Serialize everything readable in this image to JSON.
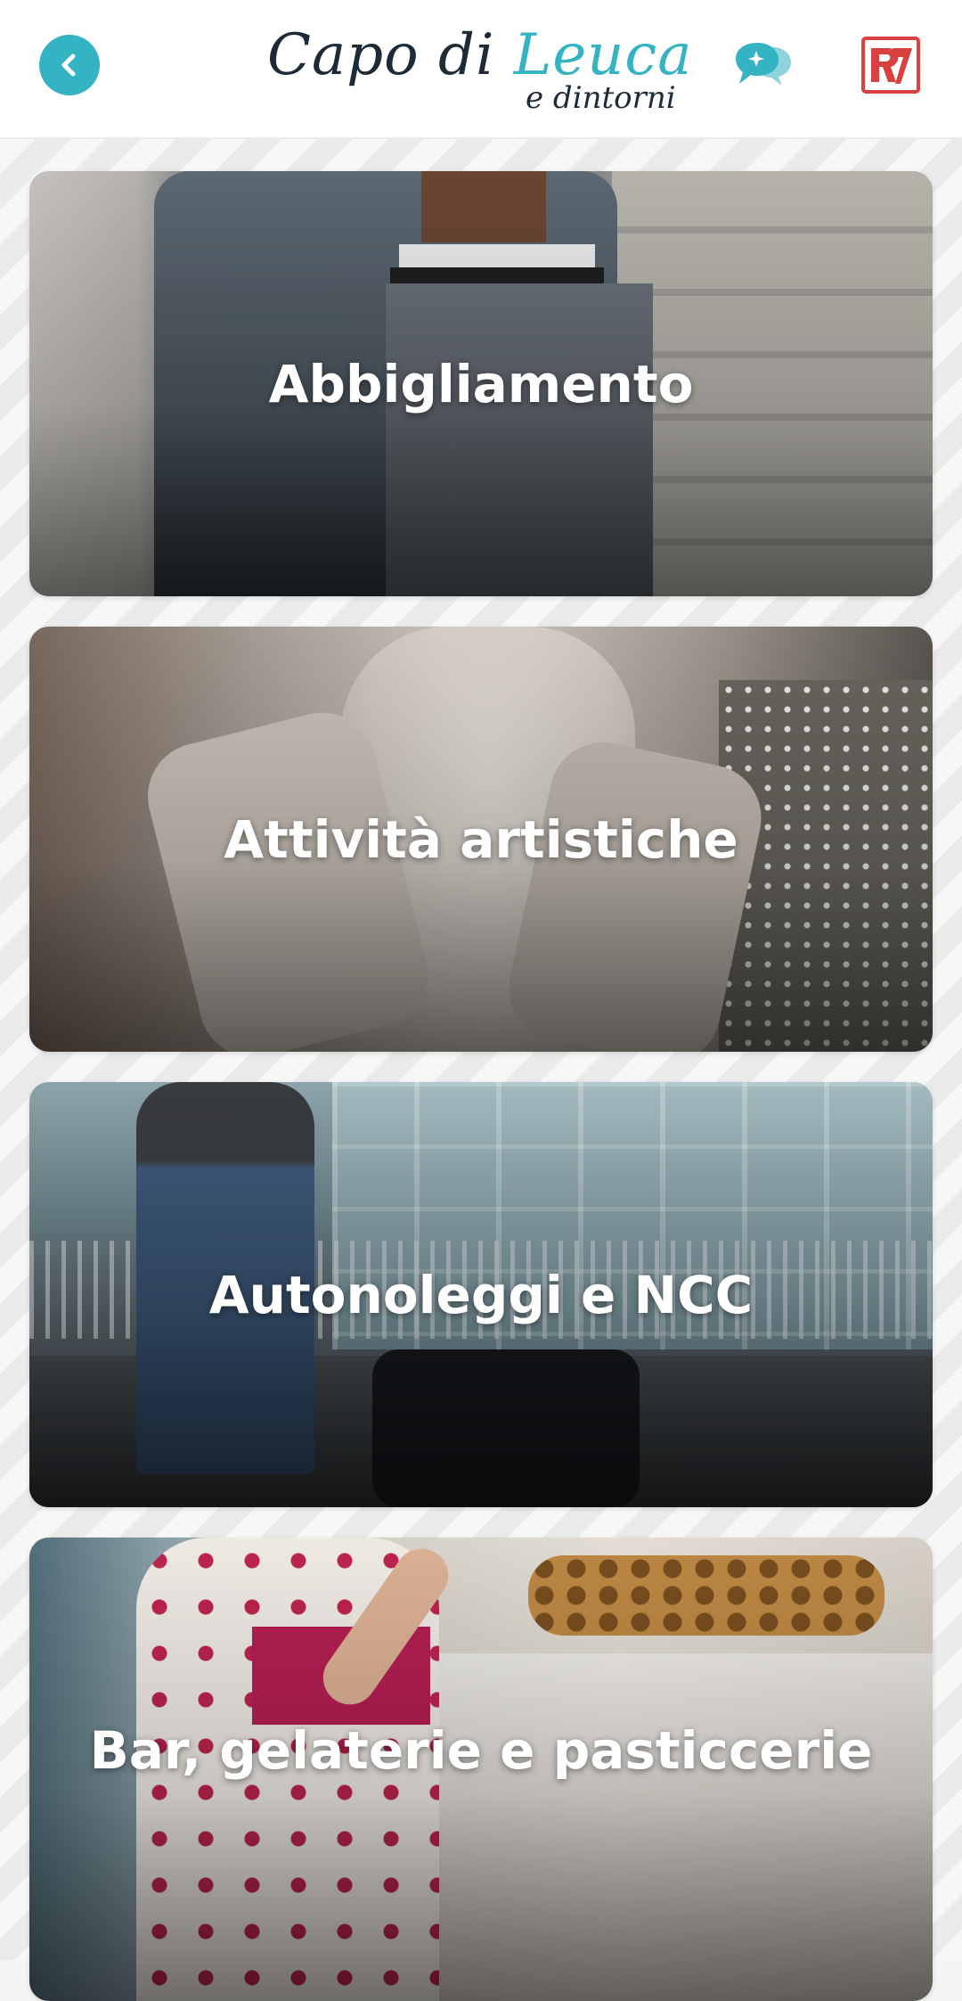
{
  "header": {
    "logo": {
      "word1": "Capo di ",
      "word2": "Leuca",
      "subtitle": "e dintorni"
    },
    "back_icon": "chevron-left-icon",
    "chat_icon": "chat-bubbles-icon",
    "brand_icon": "brand-logo-icon",
    "colors": {
      "accent": "#34b3c2",
      "logo_dark": "#1d2b38",
      "brand_red": "#d94040"
    }
  },
  "categories": [
    {
      "label": "Abbigliamento"
    },
    {
      "label": "Attività artistiche"
    },
    {
      "label": "Autonoleggi e NCC"
    },
    {
      "label": "Bar, gelaterie e pasticcerie"
    }
  ]
}
